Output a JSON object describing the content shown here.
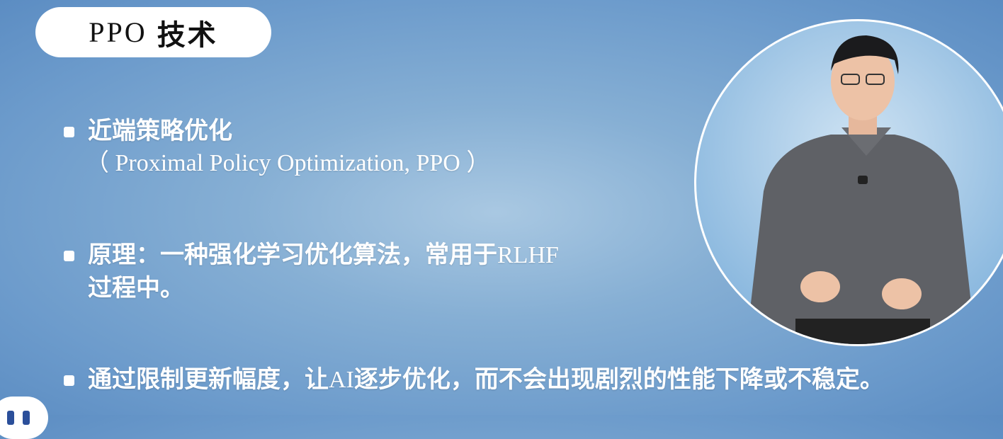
{
  "slide": {
    "title_en": "PPO",
    "title_zh": "技术",
    "bullets": [
      {
        "line1": "近端策略优化",
        "line2": "（ Proximal Policy Optimization, PPO ）"
      },
      {
        "line1_zh": "原理：一种强化学习优化算法，常用于",
        "line1_en": "RLHF",
        "line2": "过程中。"
      },
      {
        "part1": "通过限制更新幅度，让",
        "part_en": "AI",
        "part2": "逐步优化，而不会出现剧烈的性能下降或不稳定。"
      }
    ]
  },
  "colors": {
    "background": "#7fa9d2",
    "pill": "#ffffff",
    "text": "#ffffff"
  }
}
